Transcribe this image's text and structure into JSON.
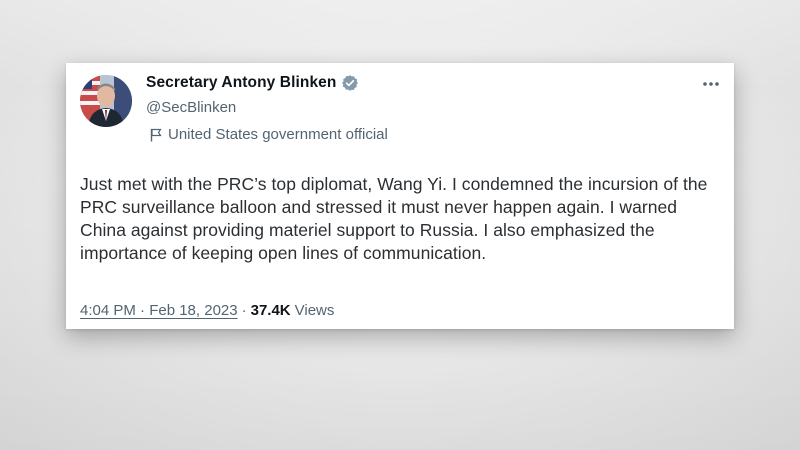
{
  "tweet": {
    "display_name": "Secretary Antony Blinken",
    "handle": "@SecBlinken",
    "gov_label": "United States government official",
    "text": "Just met with the PRC’s top diplomat, Wang Yi. I condemned the incursion of the PRC surveillance balloon and stressed it must never happen again. I warned China against providing materiel support to Russia. I also emphasized the importance of keeping open lines of communication.",
    "timestamp": "4:04 PM · Feb 18, 2023",
    "separator": "·",
    "views_count": "37.4K",
    "views_label": "Views",
    "more_icon": "more-horizontal-icon",
    "verified_icon": "verified-badge-icon",
    "gov_icon": "flag-icon"
  },
  "colors": {
    "verified_badge": "#829aab",
    "name_text": "#0f1419",
    "secondary_text": "#536471",
    "body_text": "#2b2f33"
  }
}
